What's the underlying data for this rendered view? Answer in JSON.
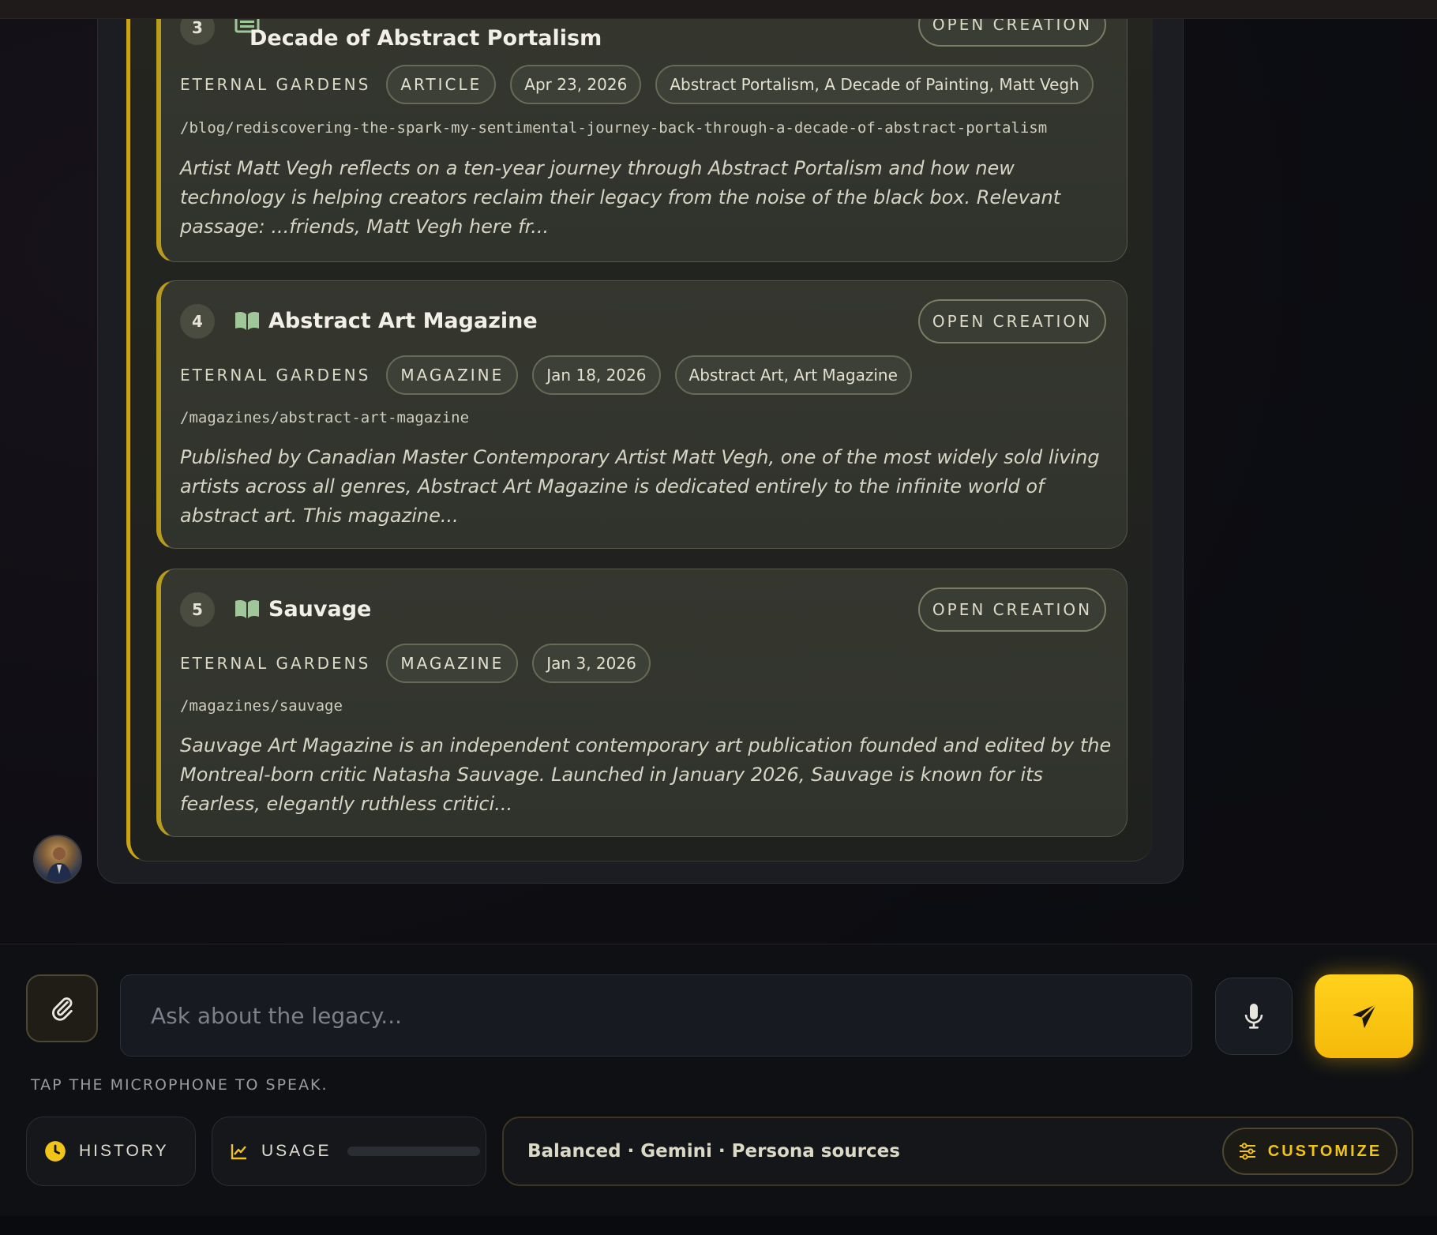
{
  "results": [
    {
      "number": "3",
      "title": "Decade of Abstract Portalism",
      "open_label": "OPEN CREATION",
      "site": "ETERNAL GARDENS",
      "type": "ARTICLE",
      "date": "Apr 23, 2026",
      "tags": "Abstract Portalism, A Decade of Painting, Matt Vegh",
      "path": "/blog/rediscovering-the-spark-my-sentimental-journey-back-through-a-decade-of-abstract-portalism",
      "excerpt": "Artist Matt Vegh reflects on a ten-year journey through Abstract Portalism and how new technology is helping creators reclaim their legacy from the noise of the black box. Relevant passage: ...friends, Matt Vegh here fr..."
    },
    {
      "number": "4",
      "title": "Abstract Art Magazine",
      "open_label": "OPEN CREATION",
      "site": "ETERNAL GARDENS",
      "type": "MAGAZINE",
      "date": "Jan 18, 2026",
      "tags": "Abstract Art, Art Magazine",
      "path": "/magazines/abstract-art-magazine",
      "excerpt": "Published by Canadian Master Contemporary Artist Matt Vegh, one of the most widely sold living artists across all genres, Abstract Art Magazine is dedicated entirely to the infinite world of abstract art. This magazine..."
    },
    {
      "number": "5",
      "title": "Sauvage",
      "open_label": "OPEN CREATION",
      "site": "ETERNAL GARDENS",
      "type": "MAGAZINE",
      "date": "Jan 3, 2026",
      "path": "/magazines/sauvage",
      "excerpt": "Sauvage Art Magazine is an independent contemporary art publication founded and edited by the Montreal-born critic Natasha Sauvage. Launched in January 2026, Sauvage is known for its fearless, elegantly ruthless critici..."
    }
  ],
  "composer": {
    "placeholder": "Ask about the legacy...",
    "hint": "TAP THE MICROPHONE TO SPEAK.",
    "attach_icon": "paperclip-icon",
    "mic_icon": "microphone-icon",
    "send_icon": "send-icon"
  },
  "footer": {
    "history_label": "HISTORY",
    "usage_label": "USAGE",
    "usage_fraction": 0.0,
    "settings_summary": "Balanced · Gemini · Persona sources",
    "customize_label": "CUSTOMIZE"
  },
  "colors": {
    "accent": "#f5b90a",
    "card_border": "#b79c1e"
  }
}
